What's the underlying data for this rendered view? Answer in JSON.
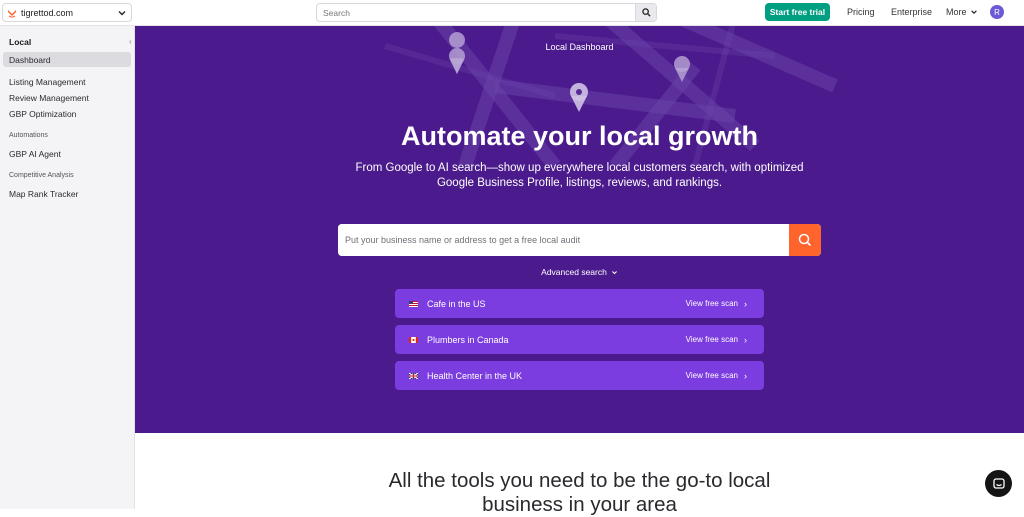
{
  "topbar": {
    "project_name": "tigrettod.com",
    "search_placeholder": "Search",
    "trial_label": "Start free trial",
    "pricing_label": "Pricing",
    "enterprise_label": "Enterprise",
    "more_label": "More",
    "avatar_initial": "R",
    "accent_green": "#009f81"
  },
  "sidebar": {
    "title": "Local",
    "items": [
      {
        "label": "Dashboard",
        "active": true
      },
      {
        "label": "Listing Management"
      },
      {
        "label": "Review Management"
      },
      {
        "label": "GBP Optimization"
      }
    ],
    "sections": [
      {
        "title": "Automations",
        "items": [
          {
            "label": "GBP AI Agent"
          }
        ]
      },
      {
        "title": "Competitive Analysis",
        "items": [
          {
            "label": "Map Rank Tracker"
          }
        ]
      }
    ]
  },
  "hero": {
    "kicker": "Local Dashboard",
    "title": "Automate your local growth",
    "subtitle_line1": "From Google to AI search—show up everywhere local customers search, with optimized",
    "subtitle_line2": "Google Business Profile, listings, reviews, and rankings.",
    "audit_placeholder": "Put your business name or address to get a free local audit",
    "advanced_label": "Advanced search",
    "bg_color": "#4b1a8c",
    "button_color": "#ff642d",
    "scans": [
      {
        "label": "Cafe in the US",
        "link": "View free scan",
        "flag": "us-flag-icon"
      },
      {
        "label": "Plumbers in Canada",
        "link": "View free scan",
        "flag": "ca-flag-icon"
      },
      {
        "label": "Health Center in the UK",
        "link": "View free scan",
        "flag": "uk-flag-icon"
      }
    ]
  },
  "tools": {
    "title_line1": "All the tools you need to be the go-to local",
    "title_line2": "business in your area"
  }
}
